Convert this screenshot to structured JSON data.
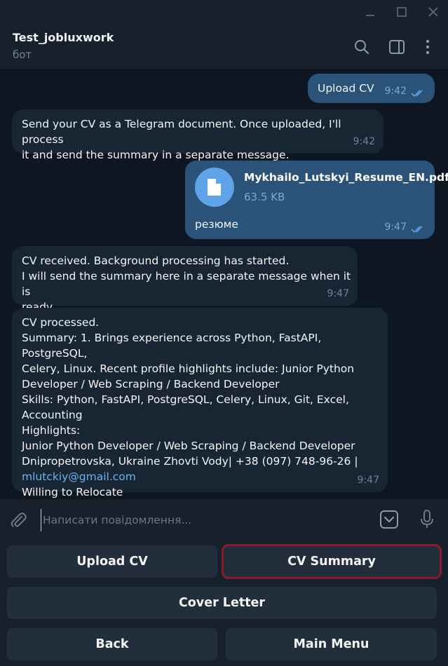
{
  "chat": {
    "title": "Test_jobluxwork",
    "status": "бот"
  },
  "messages": {
    "m1": {
      "text": "Upload CV",
      "time": "9:42"
    },
    "m2": {
      "text": "Send your CV as a Telegram document. Once uploaded, I'll process\nit and send the summary in a separate message.",
      "time": "9:42"
    },
    "m3": {
      "file_name": "Mykhailo_Lutskyi_Resume_EN.pdf",
      "file_size": "63.5 KB",
      "caption": "резюме",
      "time": "9:47"
    },
    "m4": {
      "text": "CV received. Background processing has started.\nI will send the summary here in a separate message when it is\nready.",
      "time": "9:47"
    },
    "m5": {
      "text_before": "CV processed.\nSummary: 1. Brings experience across Python, FastAPI, PostgreSQL,\nCelery, Linux. Recent profile highlights include: Junior Python\nDeveloper / Web Scraping / Backend Developer\nSkills: Python, FastAPI, PostgreSQL, Celery, Linux, Git, Excel,\nAccounting\nHighlights:\nJunior Python Developer / Web Scraping / Backend Developer\nDnipropetrovska, Ukraine Zhovti Vody| +38 (097) 748-96-26 |",
      "email": "mlutckiy@gmail.com",
      "text_after": "Willing to Relocate",
      "time": "9:47"
    }
  },
  "composer": {
    "placeholder": "Написати повідомлення..."
  },
  "keyboard": {
    "upload_cv": "Upload CV",
    "cv_summary": "CV Summary",
    "cover_letter": "Cover Letter",
    "back": "Back",
    "main_menu": "Main Menu"
  },
  "colors": {
    "background": "#0e1621",
    "incoming_bubble": "#182533",
    "outgoing_bubble": "#2b5278",
    "link": "#6ab2f2",
    "highlight_border": "#8c1a2a"
  },
  "icons": {
    "titlebar": [
      "minimize-icon",
      "maximize-icon",
      "close-icon"
    ],
    "header": [
      "search-icon",
      "sidebar-toggle-icon",
      "more-vertical-icon"
    ],
    "composer": [
      "paperclip-icon",
      "bot-keyboard-icon",
      "microphone-icon"
    ]
  }
}
